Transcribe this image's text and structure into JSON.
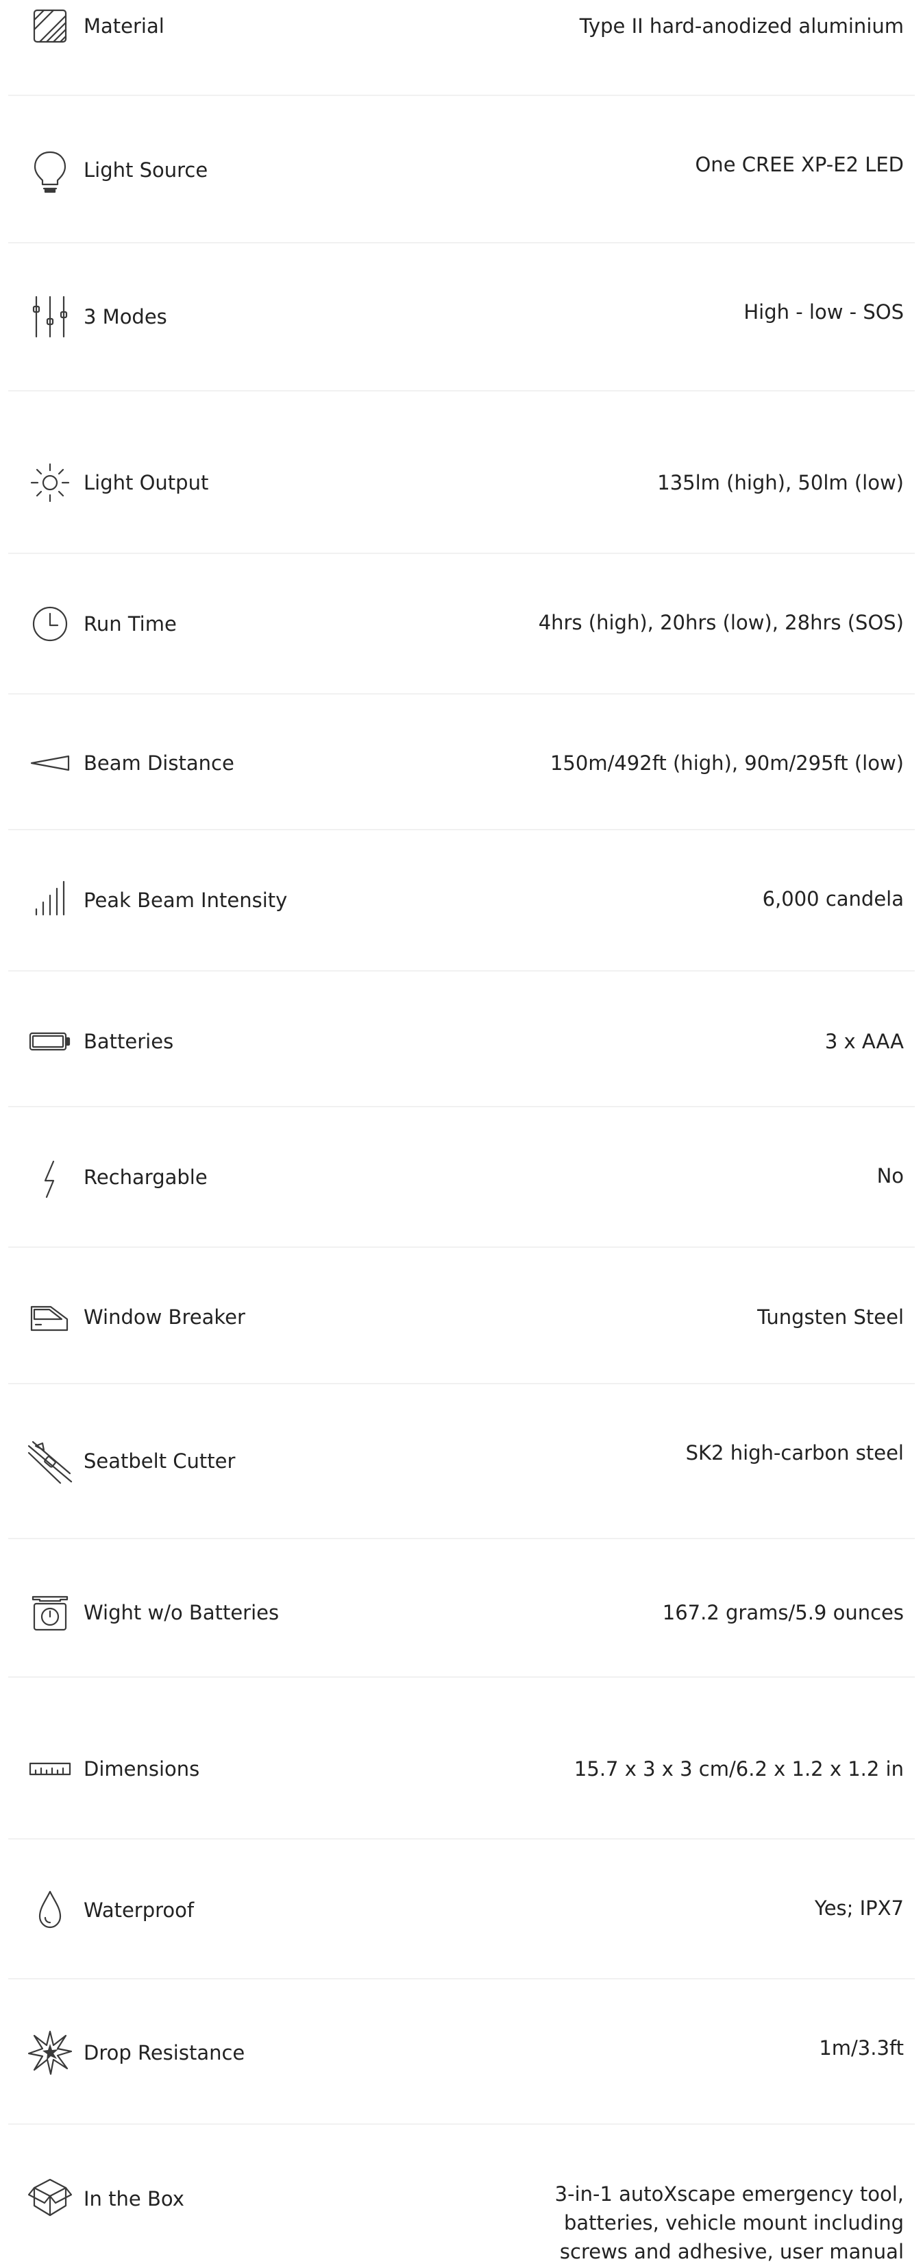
{
  "specs": [
    {
      "label": "Material",
      "value": "Type II hard-anodized aluminium",
      "icon": "material-icon"
    },
    {
      "label": "Light Source",
      "value": "One CREE XP-E2 LED",
      "icon": "bulb-icon"
    },
    {
      "label": "3 Modes",
      "value": "High - low - SOS",
      "icon": "sliders-icon"
    },
    {
      "label": "Light Output",
      "value": "135lm (high), 50lm (low)",
      "icon": "sun-icon"
    },
    {
      "label": "Run Time",
      "value": "4hrs (high), 20hrs (low), 28hrs (SOS)",
      "icon": "clock-icon"
    },
    {
      "label": "Beam Distance",
      "value": "150m/492ft (high), 90m/295ft (low)",
      "icon": "beam-icon"
    },
    {
      "label": "Peak Beam Intensity",
      "value": "6,000 candela",
      "icon": "signal-bars-icon"
    },
    {
      "label": "Batteries",
      "value": "3 x AAA",
      "icon": "battery-icon"
    },
    {
      "label": "Rechargable",
      "value": "No",
      "icon": "lightning-icon"
    },
    {
      "label": "Window Breaker",
      "value": "Tungsten Steel",
      "icon": "car-window-icon"
    },
    {
      "label": "Seatbelt Cutter",
      "value": "SK2 high-carbon steel",
      "icon": "seatbelt-cutter-icon"
    },
    {
      "label": "Wight w/o Batteries",
      "value": "167.2 grams/5.9 ounces",
      "icon": "scale-icon"
    },
    {
      "label": "Dimensions",
      "value": "15.7 x 3 x 3 cm/6.2 x 1.2 x 1.2 in",
      "icon": "ruler-icon"
    },
    {
      "label": "Waterproof",
      "value": "Yes; IPX7",
      "icon": "water-drop-icon"
    },
    {
      "label": "Drop Resistance",
      "value": "1m/3.3ft",
      "icon": "impact-icon"
    },
    {
      "label": "In the Box",
      "value": "3-in-1 autoXscape emergency tool, batteries, vehicle mount including screws and adhesive, user manual",
      "icon": "box-icon"
    }
  ]
}
